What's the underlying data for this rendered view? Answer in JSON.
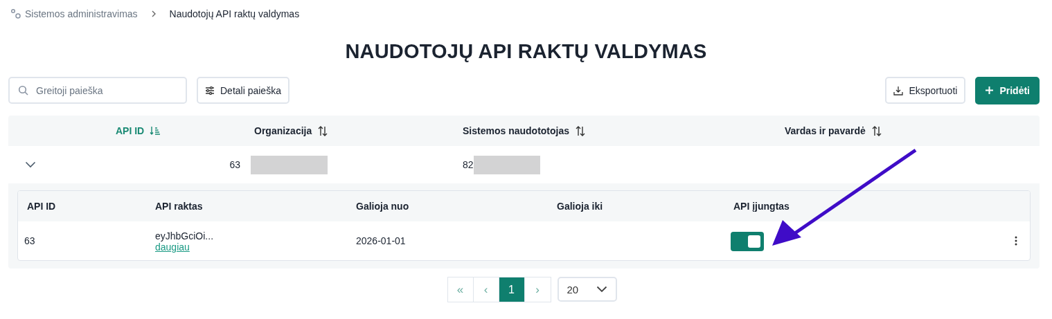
{
  "breadcrumb": [
    {
      "label": "Sistemos administravimas",
      "current": false
    },
    {
      "label": "Naudotojų API raktų valdymas",
      "current": true
    }
  ],
  "title": "NAUDOTOJŲ API RAKTŲ VALDYMAS",
  "search": {
    "placeholder": "Greitoji paieška"
  },
  "buttons": {
    "advanced_search": "Detali paieška",
    "export": "Eksportuoti",
    "add": "Pridėti"
  },
  "table": {
    "columns": [
      {
        "label": "API ID",
        "sorted": true
      },
      {
        "label": "Organizacija",
        "sorted": false
      },
      {
        "label": "Sistemos naudototojas",
        "sorted": false
      },
      {
        "label": "Vardas ir pavardė",
        "sorted": false
      }
    ],
    "rows": [
      {
        "expanded": true,
        "api_id": "63",
        "organization": {
          "redacted": true
        },
        "user": {
          "redacted": true,
          "text": "82"
        },
        "detail": {
          "columns": [
            "API ID",
            "API raktas",
            "Galioja nuo",
            "Galioja iki",
            "API įjungtas"
          ],
          "rows": [
            {
              "api_id": "63",
              "key": "eyJhbGciOi...",
              "more": "daugiau",
              "valid_from": "2026-01-01",
              "enabled": true
            }
          ]
        }
      }
    ]
  },
  "pagination": {
    "first": "«",
    "prev": "‹",
    "pages": [
      {
        "label": "1",
        "selected": true
      }
    ],
    "next": "›",
    "page_size": "20"
  },
  "annotation": {
    "kind": "arrow",
    "color": "#3f0cc7"
  }
}
